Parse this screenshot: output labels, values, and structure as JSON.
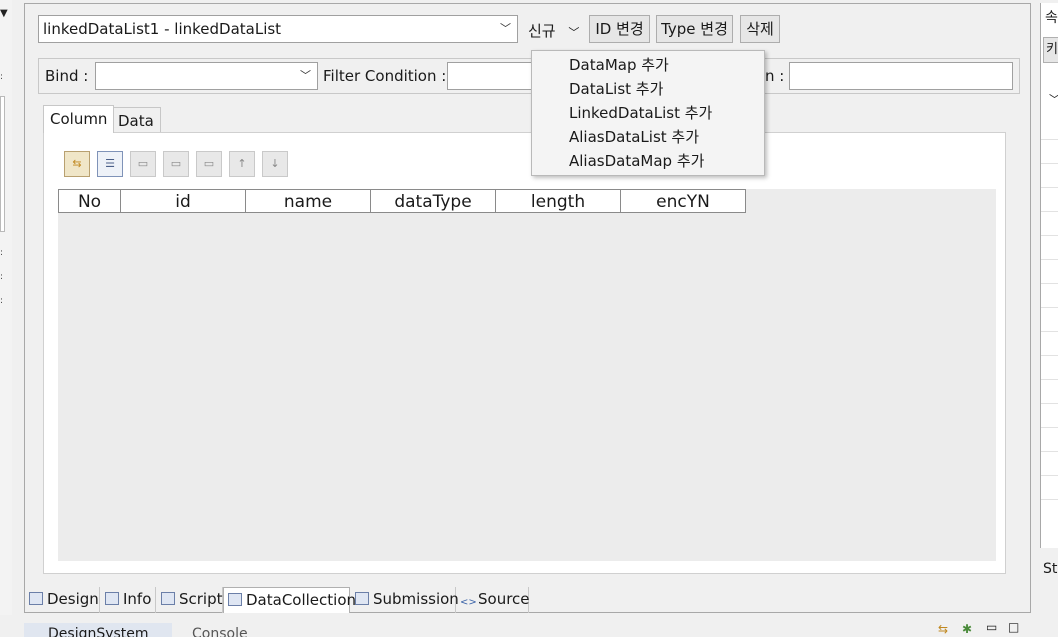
{
  "header": {
    "collection_select": "linkedDataList1 - linkedDataList",
    "new_label": "신규",
    "id_change_label": "ID 변경",
    "type_change_label": "Type 변경",
    "delete_label": "삭제"
  },
  "filter_row": {
    "bind_label": "Bind :",
    "bind_value": "",
    "filter_label": "Filter Condition :",
    "filter_value": "",
    "third_label": "n :",
    "third_value": ""
  },
  "tabs": [
    {
      "label": "Column"
    },
    {
      "label": "Data"
    }
  ],
  "grid": {
    "columns": [
      "No",
      "id",
      "name",
      "dataType",
      "length",
      "encYN"
    ]
  },
  "new_menu": {
    "items": [
      "DataMap 추가",
      "DataList 추가",
      "LinkedDataList 추가",
      "AliasDataList 추가",
      "AliasDataMap 추가"
    ]
  },
  "bottom_tabs": [
    {
      "label": "Design",
      "icon": "design-icon"
    },
    {
      "label": "Info",
      "icon": "info-icon"
    },
    {
      "label": "Script",
      "icon": "script-icon"
    },
    {
      "label": "DataCollection",
      "icon": "datacollection-icon"
    },
    {
      "label": "Submission",
      "icon": "submission-icon"
    },
    {
      "label": "Source",
      "icon": "source-icon"
    }
  ],
  "right_panel": {
    "tab_a": "속",
    "tab_b": "키",
    "label_sty": "Sty"
  },
  "bottom_views": {
    "view1": "DesignSystem",
    "view2": "Console"
  }
}
